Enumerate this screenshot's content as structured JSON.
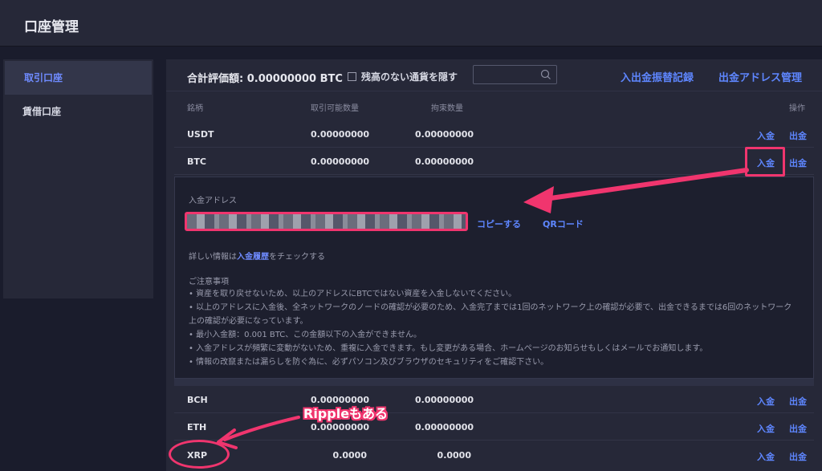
{
  "header": {
    "title": "口座管理"
  },
  "sidebar": {
    "items": [
      {
        "label": "取引口座",
        "active": true
      },
      {
        "label": "賃借口座",
        "active": false
      }
    ]
  },
  "summary": {
    "total_label": "合計評価額: 0.00000000 BTC",
    "hide_zero_label": "残高のない通貨を隠す",
    "search_placeholder": "",
    "history_link": "入出金振替記録",
    "address_mgmt_link": "出金アドレス管理"
  },
  "table": {
    "headers": {
      "symbol": "銘柄",
      "available": "取引可能数量",
      "locked": "拘束数量",
      "actions": "操作"
    },
    "rows": [
      {
        "symbol": "USDT",
        "available": "0.00000000",
        "locked": "0.00000000",
        "deposit": "入金",
        "withdraw": "出金"
      },
      {
        "symbol": "BTC",
        "available": "0.00000000",
        "locked": "0.00000000",
        "deposit": "入金",
        "withdraw": "出金"
      },
      {
        "symbol": "BCH",
        "available": "0.00000000",
        "locked": "0.00000000",
        "deposit": "入金",
        "withdraw": "出金"
      },
      {
        "symbol": "ETH",
        "available": "0.00000000",
        "locked": "0.00000000",
        "deposit": "入金",
        "withdraw": "出金"
      },
      {
        "symbol": "XRP",
        "available": "0.0000",
        "locked": "0.0000",
        "deposit": "入金",
        "withdraw": "出金"
      }
    ]
  },
  "deposit_panel": {
    "address_label": "入金アドレス",
    "copy_label": "コピーする",
    "qr_label": "QRコード",
    "detail_prefix": "詳しい情報は",
    "detail_link": "入金履歴",
    "detail_suffix": "をチェックする",
    "notes_title": "ご注意事項",
    "notes": [
      "• 資産を取り戻せないため、以上のアドレスにBTCではない資産を入金しないでください。",
      "• 以上のアドレスに入金後、全ネットワークのノードの確認が必要のため、入金完了までは1回のネットワーク上の確認が必要で、出金できるまでは6回のネットワーク",
      "上の確認が必要になっています。",
      "• 最小入金額：0.001 BTC、この金額以下の入金ができません。",
      "• 入金アドレスが頻繁に変動がないため、重複に入金できます。もし変更がある場合、ホームページのお知らせもしくはメールでお通知します。",
      "• 情報の改竄または漏らしを防ぐ為に、必ずパソコン及びブラウザのセキュリティをご確認下さい。"
    ]
  },
  "annotations": {
    "ripple_callout": "Rippleもある",
    "highlight_color": "#f0356e"
  },
  "colors": {
    "background": "#1a1c2c",
    "panel": "#262838",
    "accent": "#5e86ff"
  }
}
